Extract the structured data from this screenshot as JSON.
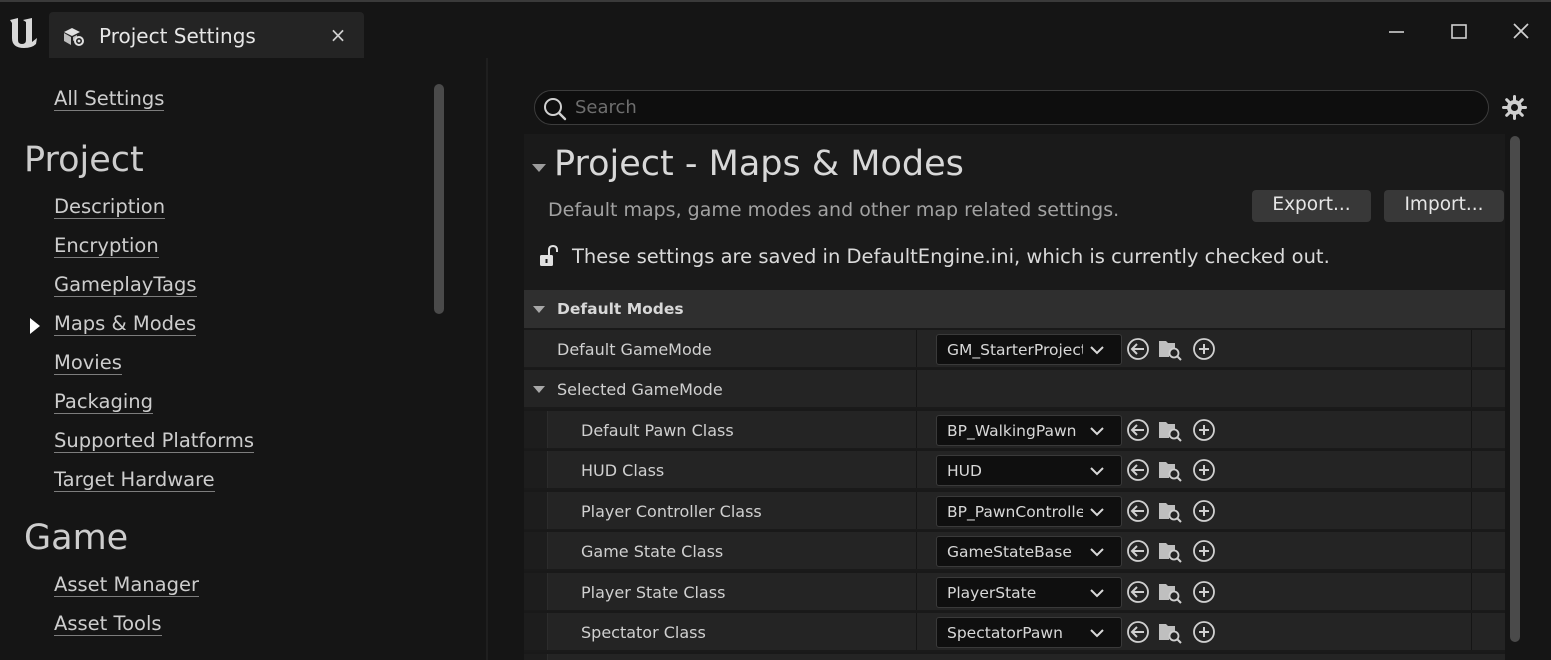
{
  "window": {
    "tab_title": "Project Settings",
    "tab_close": "×"
  },
  "sidebar": {
    "all_settings": "All Settings",
    "groups": [
      {
        "heading": "Project",
        "items": [
          "Description",
          "Encryption",
          "GameplayTags",
          "Maps & Modes",
          "Movies",
          "Packaging",
          "Supported Platforms",
          "Target Hardware"
        ]
      },
      {
        "heading": "Game",
        "items": [
          "Asset Manager",
          "Asset Tools"
        ]
      }
    ],
    "selected": "Maps & Modes"
  },
  "search": {
    "placeholder": "Search",
    "value": ""
  },
  "section": {
    "title": "Project - Maps & Modes",
    "description": "Default maps, game modes and other map related settings.",
    "export_label": "Export...",
    "import_label": "Import...",
    "config_note": "These settings are saved in DefaultEngine.ini, which is currently checked out."
  },
  "properties": {
    "category": "Default Modes",
    "default_gamemode": {
      "label": "Default GameMode",
      "value": "GM_StarterProject"
    },
    "selected_gamemode": {
      "label": "Selected GameMode"
    },
    "rows": [
      {
        "label": "Default Pawn Class",
        "value": "BP_WalkingPawn"
      },
      {
        "label": "HUD Class",
        "value": "HUD"
      },
      {
        "label": "Player Controller Class",
        "value": "BP_PawnController"
      },
      {
        "label": "Game State Class",
        "value": "GameStateBase"
      },
      {
        "label": "Player State Class",
        "value": "PlayerState"
      },
      {
        "label": "Spectator Class",
        "value": "SpectatorPawn"
      }
    ]
  },
  "icons": {
    "logo": "unreal-logo-icon",
    "tab": "project-settings-icon",
    "lock": "unlocked-icon",
    "search": "search-icon",
    "settings": "gear-icon",
    "row_actions": [
      "back-arrow-icon",
      "browse-folder-icon",
      "add-icon"
    ]
  },
  "colors": {
    "background": "#151515",
    "panel": "#1a1a1a",
    "row": "#242424",
    "category_header": "#2f2f2f",
    "text": "#d0d0d0"
  }
}
